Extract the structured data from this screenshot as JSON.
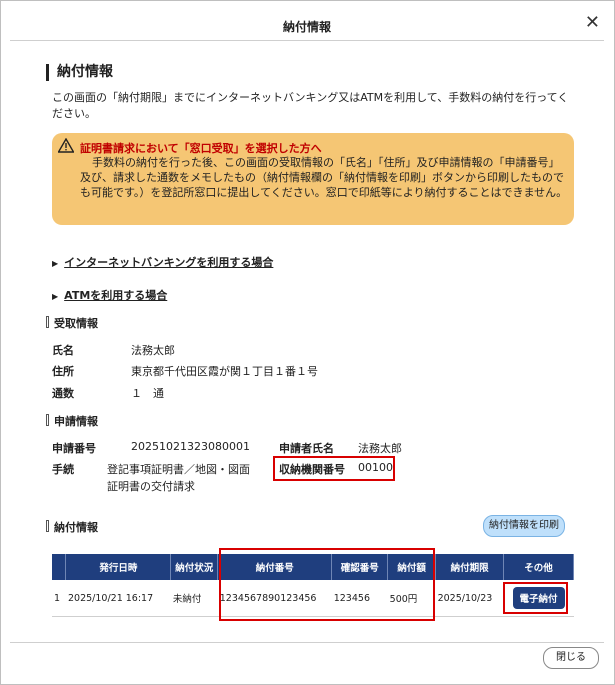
{
  "dialog": {
    "title": "納付情報",
    "close_glyph": "✕"
  },
  "section_title": "納付情報",
  "intro": "この画面の「納付期限」までにインターネットバンキング又はATMを利用して、手数料の納付を行ってください。",
  "warning": {
    "heading": "証明書請求において「窓口受取」を選択した方へ",
    "body": "手数料の納付を行った後、この画面の受取情報の「氏名」「住所」及び申請情報の「申請番号」及び、請求した通数をメモしたもの（納付情報欄の「納付情報を印刷」ボタンから印刷したものでも可能です。）を登記所窓口に提出してください。窓口で印紙等により納付することはできません。",
    "color": "#f5c674"
  },
  "links": {
    "internet_banking": "インターネットバンキングを利用する場合",
    "atm": "ATMを利用する場合"
  },
  "receipt": {
    "heading": "受取情報",
    "name_label": "氏名",
    "name": "法務太郎",
    "address_label": "住所",
    "address": "東京都千代田区霞が関１丁目１番１号",
    "copies_label": "通数",
    "copies": "１　通"
  },
  "application": {
    "heading": "申請情報",
    "number_label": "申請番号",
    "number": "20251021323080001",
    "applicant_label": "申請者氏名",
    "applicant": "法務太郎",
    "procedure_label": "手続",
    "procedure_line1": "登記事項証明書／地図・図面",
    "procedure_line2": "証明書の交付請求",
    "org_label": "収納機関番号",
    "org_number": "00100"
  },
  "payment": {
    "heading": "納付情報",
    "print_button": "納付情報を印刷",
    "columns": [
      "発行日時",
      "納付状況",
      "納付番号",
      "確認番号",
      "納付額",
      "納付期限",
      "その他"
    ],
    "row": {
      "index": "1",
      "issued": "2025/10/21 16:17",
      "status": "未納付",
      "payment_number": "1234567890123456",
      "confirm_number": "123456",
      "amount": "500円",
      "deadline": "2025/10/23",
      "action": "電子納付"
    }
  },
  "footer": {
    "close_button": "閉じる"
  }
}
